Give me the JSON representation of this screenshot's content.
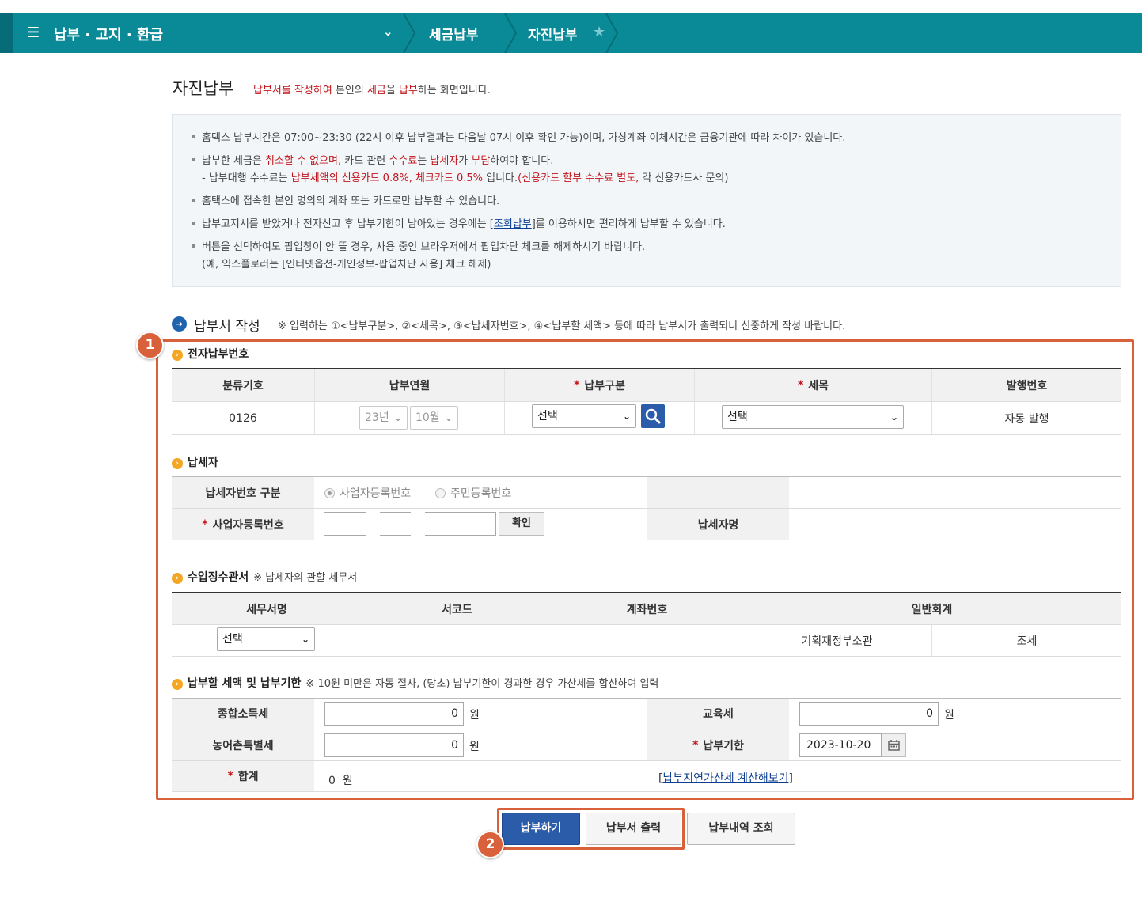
{
  "nav": {
    "menu_icon": "☰",
    "title": "납부 · 고지 · 환급",
    "crumb1": "세금납부",
    "crumb2": "자진납부"
  },
  "header": {
    "title": "자진납부",
    "desc_1": "납부서를 작성하여",
    "desc_2": " 본인의 ",
    "desc_3": "세금",
    "desc_4": "을 ",
    "desc_5": "납부",
    "desc_6": "하는 화면입니다."
  },
  "notice": {
    "l1": "홈택스 납부시간은 07:00~23:30 (22시 이후 납부결과는 다음날 07시 이후 확인 가능)이며, 가상계좌 이체시간은 금융기관에 따라 차이가 있습니다.",
    "l2a": "납부한 세금은 ",
    "l2b": "취소할 수 없으며,",
    "l2c": " 카드 관련 ",
    "l2d": "수수료",
    "l2e": "는 ",
    "l2f": "납세자",
    "l2g": "가 ",
    "l2h": "부담",
    "l2i": "하여야 합니다.",
    "l3a": "- 납부대행 수수료는 ",
    "l3b": "납부세액의 신용카드 0.8%, 체크카드 0.5%",
    "l3c": " 입니다.",
    "l3d": "(신용카드 할부 수수료 별도,",
    "l3e": " 각 신용카드사 문의)",
    "l4": "홈택스에 접속한 본인 명의의 계좌 또는 카드로만 납부할 수 있습니다.",
    "l5a": "납부고지서를 받았거나 전자신고 후 납부기한이 남아있는 경우에는 [",
    "l5b": "조회납부",
    "l5c": "]를 이용하시면 편리하게  납부할 수 있습니다.",
    "l6": "버튼을 선택하여도 팝업창이 안 뜰 경우, 사용 중인 브라우저에서 팝업차단 체크를 해제하시기 바랍니다.",
    "l7": "(예, 익스플로러는 [인터넷옵션-개인정보-팝업차단 사용] 체크 해제)"
  },
  "section": {
    "title": "납부서 작성",
    "note": "※ 입력하는 ①<납부구분>, ②<세목>, ③<납세자번호>, ④<납부할 세액> 등에 따라 납부서가 출력되니 신중하게 작성 바랍니다."
  },
  "badges": {
    "one": "1",
    "two": "2"
  },
  "e_pay": {
    "title": "전자납부번호",
    "headers": {
      "code": "분류기호",
      "ym": "납부연월",
      "type": "납부구분",
      "item": "세목",
      "issue": "발행번호"
    },
    "required_mark": "*",
    "code_value": "0126",
    "year": "23년",
    "month": "10월",
    "type_select": "선택",
    "item_select": "선택",
    "issue_value": "자동 발행"
  },
  "taxpayer": {
    "title": "납세자",
    "num_type_label": "납세자번호 구분",
    "radio_biz": "사업자등록번호",
    "radio_resident": "주민등록번호",
    "biz_no_label": "사업자등록번호",
    "confirm_button": "확인",
    "name_label": "납세자명"
  },
  "office": {
    "title": "수입징수관서",
    "note": "※ 납세자의 관할 세무서",
    "headers": {
      "name": "세무서명",
      "code": "서코드",
      "account": "계좌번호",
      "general": "일반회계"
    },
    "office_select": "선택",
    "ministry": "기획재정부소관",
    "tax": "조세"
  },
  "amount": {
    "title": "납부할 세액 및 납부기한",
    "note": "※ 10원 미만은 자동 절사, (당초) 납부기한이 경과한 경우 가산세를 합산하여 입력",
    "income_tax_label": "종합소득세",
    "income_tax_value": "0",
    "edu_tax_label": "교육세",
    "edu_tax_value": "0",
    "rural_tax_label": "농어촌특별세",
    "rural_tax_value": "0",
    "due_label": "납부기한",
    "due_value": "2023-10-20",
    "total_label": "합계",
    "total_value": "0",
    "won": "원",
    "penalty_link": "납부지연가산세 계산해보기"
  },
  "buttons": {
    "pay": "납부하기",
    "print": "납부서 출력",
    "history": "납부내역 조회"
  },
  "colors": {
    "nav": "#0a8a97",
    "accent": "#d8613c",
    "primary": "#2a5caa",
    "required": "#c0151b"
  }
}
